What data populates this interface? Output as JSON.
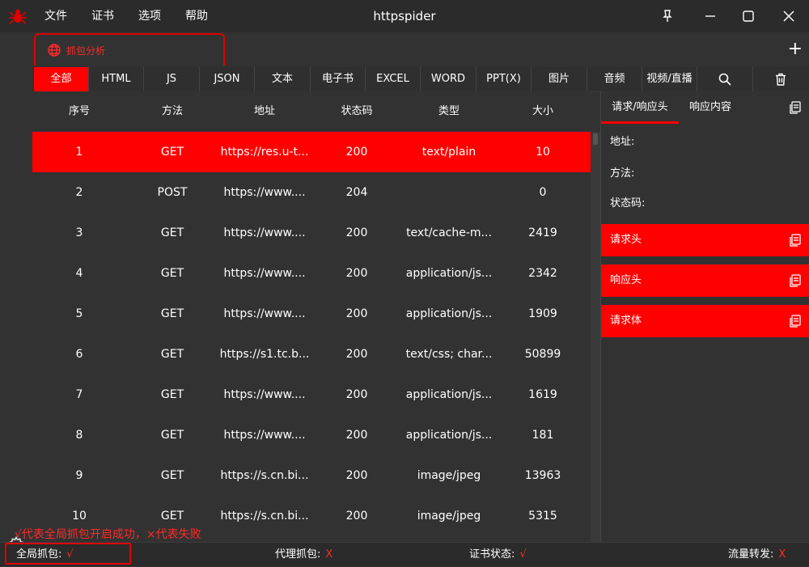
{
  "window": {
    "title": "httpspider",
    "menu": [
      "文件",
      "证书",
      "选项",
      "帮助"
    ],
    "icons": [
      "spider-icon",
      "pin-icon",
      "minimize-icon",
      "maximize-icon",
      "close-icon"
    ]
  },
  "tab": {
    "label": "抓包分析",
    "icon": "globe-icon",
    "add_label": "+"
  },
  "filters": {
    "items": [
      "全部",
      "HTML",
      "JS",
      "JSON",
      "文本",
      "电子书",
      "EXCEL",
      "WORD",
      "PPT(X)",
      "图片",
      "音频",
      "视频/直播"
    ],
    "active": "全部",
    "tools": [
      "search-icon",
      "trash-icon"
    ]
  },
  "table": {
    "columns": [
      "序号",
      "方法",
      "地址",
      "状态码",
      "类型",
      "大小"
    ],
    "rows": [
      [
        "1",
        "GET",
        "https://res.u-t...",
        "200",
        "text/plain",
        "10"
      ],
      [
        "2",
        "POST",
        "https://www....",
        "204",
        "",
        "0"
      ],
      [
        "3",
        "GET",
        "https://www....",
        "200",
        "text/cache-m...",
        "2419"
      ],
      [
        "4",
        "GET",
        "https://www....",
        "200",
        "application/js...",
        "2342"
      ],
      [
        "5",
        "GET",
        "https://www....",
        "200",
        "application/js...",
        "1909"
      ],
      [
        "6",
        "GET",
        "https://s1.tc.b...",
        "200",
        "text/css; char...",
        "50899"
      ],
      [
        "7",
        "GET",
        "https://www....",
        "200",
        "application/js...",
        "1619"
      ],
      [
        "8",
        "GET",
        "https://www....",
        "200",
        "application/js...",
        "181"
      ],
      [
        "9",
        "GET",
        "https://s.cn.bi...",
        "200",
        "image/jpeg",
        "13963"
      ],
      [
        "10",
        "GET",
        "https://s.cn.bi...",
        "200",
        "image/jpeg",
        "5315"
      ]
    ],
    "selected_row": 0
  },
  "detail": {
    "tabs": [
      "请求/响应头",
      "响应内容"
    ],
    "active_tab": "请求/响应头",
    "fields": [
      "地址:",
      "方法:",
      "状态码:"
    ],
    "sections": [
      "请求头",
      "响应头",
      "请求体"
    ]
  },
  "status": {
    "items": [
      {
        "label": "全局抓包:",
        "value": "√"
      },
      {
        "label": "代理抓包:",
        "value": "X"
      },
      {
        "label": "证书状态:",
        "value": "√"
      },
      {
        "label": "流量转发:",
        "value": "X"
      }
    ],
    "note": "√代表全局抓包开启成功，×代表失败"
  },
  "colors": {
    "accent": "#ff0000",
    "background": "#323232",
    "titlebar": "#2b2b2b"
  }
}
